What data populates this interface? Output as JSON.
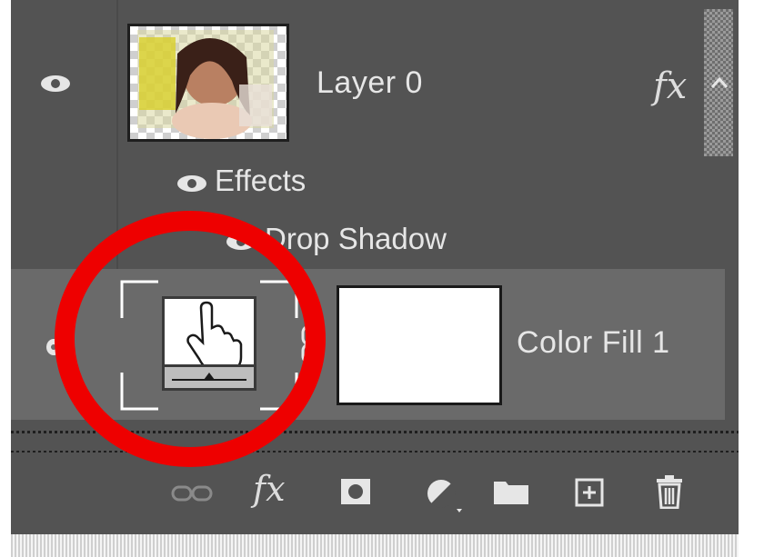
{
  "layers": [
    {
      "name": "Layer 0",
      "visible": true,
      "fx_label": "fx",
      "effects": {
        "label": "Effects",
        "items": [
          {
            "label": "Drop Shadow"
          }
        ]
      }
    },
    {
      "name": "Color Fill 1",
      "visible": true,
      "selected": true
    }
  ],
  "toolbar": {
    "icons": [
      "link-layers-icon",
      "fx-icon",
      "add-mask-icon",
      "adjustment-layer-icon",
      "new-group-icon",
      "new-layer-icon",
      "delete-icon"
    ],
    "fx_label": "fx"
  },
  "colors": {
    "panel_bg": "#535353",
    "selected_row_bg": "#6a6a6a",
    "text": "#e6e6e6",
    "annotation_circle": "#ee0000"
  }
}
